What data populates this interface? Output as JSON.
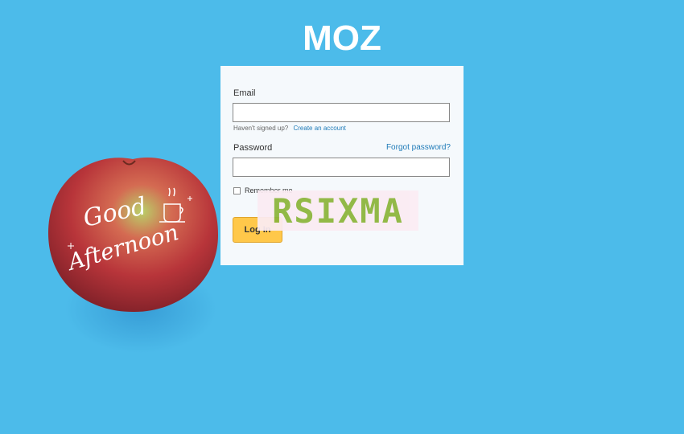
{
  "brand": {
    "logo_text": "MOZ",
    "logo_color": "#ffffff"
  },
  "background_color": "#4cbbea",
  "illustration": {
    "line1": "Good",
    "line2": "Afternoon",
    "icon": "apple-icon"
  },
  "login_form": {
    "email_label": "Email",
    "email_value": "",
    "signup_prompt": "Haven't signed up?",
    "signup_link": "Create an account",
    "password_label": "Password",
    "password_value": "",
    "forgot_link": "Forgot password?",
    "remember_label": "Remember me",
    "remember_checked": false,
    "login_button": "Log In",
    "button_color": "#ffc84a",
    "link_color": "#1f7bb8"
  },
  "captcha": {
    "text": "RSIXMA",
    "text_color": "#8bb53a",
    "background": "#fbecf3"
  }
}
